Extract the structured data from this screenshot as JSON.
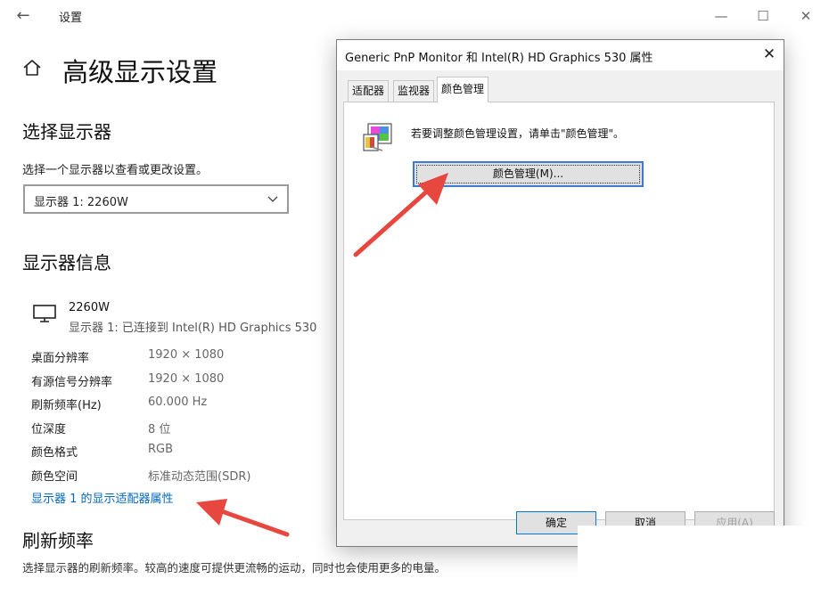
{
  "window": {
    "back_glyph": "←",
    "title": "设置",
    "minimize_glyph": "—",
    "maximize_glyph": "☐",
    "close_glyph": "✕"
  },
  "page": {
    "title": "高级显示设置"
  },
  "select_display": {
    "heading": "选择显示器",
    "description": "选择一个显示器以查看或更改设置。",
    "selected_value": "显示器 1: 2260W"
  },
  "display_info": {
    "heading": "显示器信息",
    "monitor_name": "2260W",
    "monitor_connection": "显示器 1: 已连接到 Intel(R) HD Graphics 530",
    "rows": [
      {
        "key": "桌面分辨率",
        "value": "1920 × 1080"
      },
      {
        "key": "有源信号分辨率",
        "value": "1920 × 1080"
      },
      {
        "key": "刷新频率(Hz)",
        "value": "60.000 Hz"
      },
      {
        "key": "位深度",
        "value": "8 位"
      },
      {
        "key": "颜色格式",
        "value": "RGB"
      },
      {
        "key": "颜色空间",
        "value": "标准动态范围(SDR)"
      }
    ],
    "adapter_link": "显示器 1 的显示适配器属性"
  },
  "refresh_rate": {
    "heading": "刷新频率",
    "description": "选择显示器的刷新频率。较高的速度可提供更流畅的运动，同时也会使用更多的电量。"
  },
  "dialog": {
    "title": "Generic PnP Monitor 和 Intel(R) HD Graphics 530 属性",
    "close_glyph": "✕",
    "tabs": [
      {
        "label": "适配器"
      },
      {
        "label": "监视器"
      },
      {
        "label": "颜色管理",
        "active": true
      }
    ],
    "color_mgmt_text": "若要调整颜色管理设置，请单击\"颜色管理\"。",
    "color_mgmt_button": "颜色管理(M)...",
    "ok_button": "确定",
    "cancel_button": "取消",
    "apply_button": "应用(A)"
  },
  "colors": {
    "accent_link": "#0067c0",
    "annotation_arrow": "#e8473f",
    "focus_border": "#3c7bd4"
  },
  "icons": {
    "home": "home-icon",
    "monitor": "monitor-icon",
    "chevron": "chevron-down-icon",
    "color_management": "color-management-icon"
  }
}
